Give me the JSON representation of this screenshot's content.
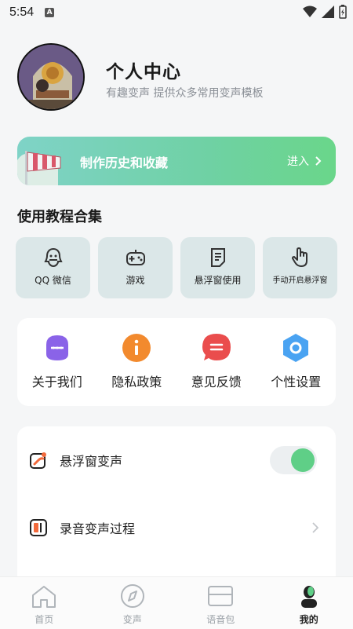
{
  "status": {
    "time": "5:54",
    "notif": "A"
  },
  "profile": {
    "title": "个人中心",
    "subtitle": "有趣变声  提供众多常用变声模板"
  },
  "history_banner": {
    "label": "制作历史和收藏",
    "enter": "进入"
  },
  "tutorials": {
    "title": "使用教程合集",
    "items": [
      {
        "label": "QQ 微信",
        "icon": "qq-icon"
      },
      {
        "label": "游戏",
        "icon": "gamepad-icon"
      },
      {
        "label": "悬浮窗使用",
        "icon": "document-icon"
      },
      {
        "label": "手动开启悬浮窗",
        "icon": "hand-pointer-icon"
      }
    ]
  },
  "menu": {
    "items": [
      {
        "label": "关于我们",
        "icon": "about-icon",
        "color": "#8a63e8"
      },
      {
        "label": "隐私政策",
        "icon": "info-icon",
        "color": "#f28a2e"
      },
      {
        "label": "意见反馈",
        "icon": "feedback-icon",
        "color": "#ea4d4d"
      },
      {
        "label": "个性设置",
        "icon": "settings-icon",
        "color": "#4aa3f2"
      }
    ]
  },
  "settings": {
    "floating": {
      "label": "悬浮窗变声",
      "enabled": true
    },
    "record": {
      "label": "录音变声过程"
    }
  },
  "tabbar": {
    "items": [
      {
        "label": "首页",
        "icon": "home-icon",
        "active": false
      },
      {
        "label": "变声",
        "icon": "compass-icon",
        "active": false
      },
      {
        "label": "语音包",
        "icon": "voicepack-icon",
        "active": false
      },
      {
        "label": "我的",
        "icon": "profile-icon",
        "active": true
      }
    ]
  },
  "colors": {
    "accent": "#5fcf87",
    "banner_start": "#7fd3c7",
    "banner_end": "#6ad68a"
  }
}
